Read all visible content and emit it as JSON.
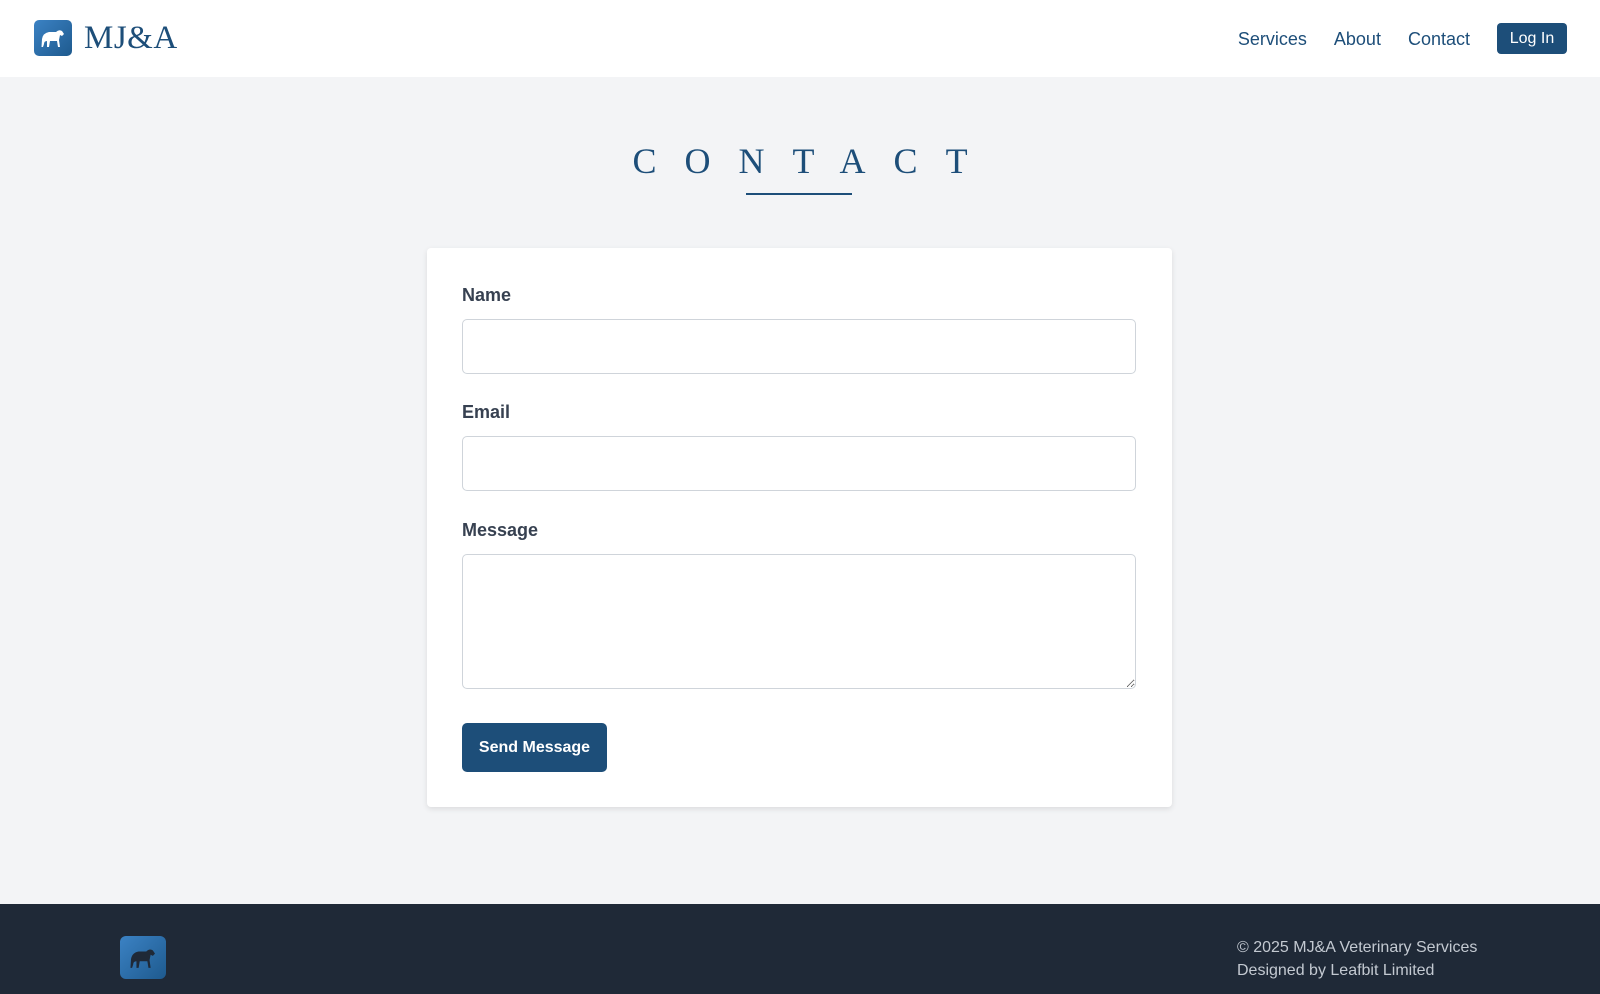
{
  "brand": {
    "name": "MJ&A",
    "logo_icon": "horse-icon"
  },
  "nav": {
    "items": [
      {
        "label": "Services"
      },
      {
        "label": "About"
      },
      {
        "label": "Contact"
      }
    ],
    "login_label": "Log In"
  },
  "page": {
    "title": "CONTACT"
  },
  "form": {
    "name_label": "Name",
    "name_value": "",
    "email_label": "Email",
    "email_value": "",
    "message_label": "Message",
    "message_value": "",
    "submit_label": "Send Message"
  },
  "footer": {
    "copyright": "© 2025 MJ&A Veterinary Services",
    "credit": "Designed by Leafbit Limited"
  },
  "colors": {
    "primary": "#1d4e79",
    "background": "#f3f4f6",
    "footer_bg": "#1f2937",
    "footer_text": "#c3c9d1"
  }
}
